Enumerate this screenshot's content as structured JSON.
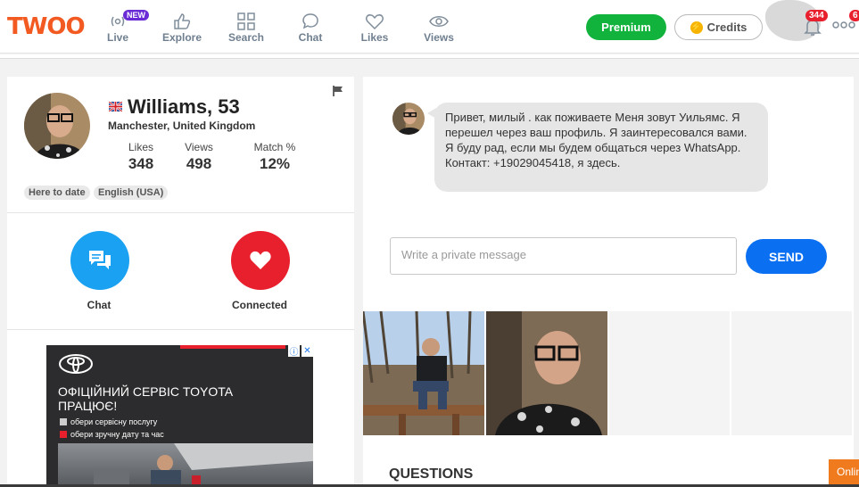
{
  "brand": {
    "logo_text": "TWOO",
    "accent": "#f25a22"
  },
  "nav": {
    "live": "Live",
    "new_badge": "NEW",
    "explore": "Explore",
    "search": "Search",
    "chat": "Chat",
    "likes": "Likes",
    "views": "Views"
  },
  "header": {
    "premium": "Premium",
    "credits": "Credits",
    "notifications_count": "344",
    "messages_count": "6"
  },
  "profile": {
    "name_age": "Williams, 53",
    "location": "Manchester, United Kingdom",
    "stats": [
      {
        "label": "Likes",
        "value": "348"
      },
      {
        "label": "Views",
        "value": "498"
      },
      {
        "label": "Match %",
        "value": "12%"
      }
    ],
    "tags": [
      "Here to date",
      "English (USA)"
    ],
    "actions": {
      "chat": "Chat",
      "connected": "Connected"
    }
  },
  "ad": {
    "title": "ОФІЦІЙНИЙ СЕРВІС TOYOTA ПРАЦЮЄ!",
    "options": [
      "обери сервісну послугу",
      "обери зручну дату та час"
    ]
  },
  "chat": {
    "message": "Привет, милый . как поживаете Меня зовут Уильямс. Я перешел через ваш профиль. Я заинтересовался вами. Я буду рад, если мы будем общаться через WhatsApp. Контакт: +19029045418, я здесь.",
    "input_placeholder": "Write a private message",
    "send": "SEND"
  },
  "sections": {
    "questions": "QUESTIONS"
  },
  "online_tab": "Onlin",
  "colors": {
    "premium": "#12b33d",
    "send": "#0b6ff2",
    "chat_button": "#1ba1f2",
    "connected_button": "#e8202e"
  }
}
